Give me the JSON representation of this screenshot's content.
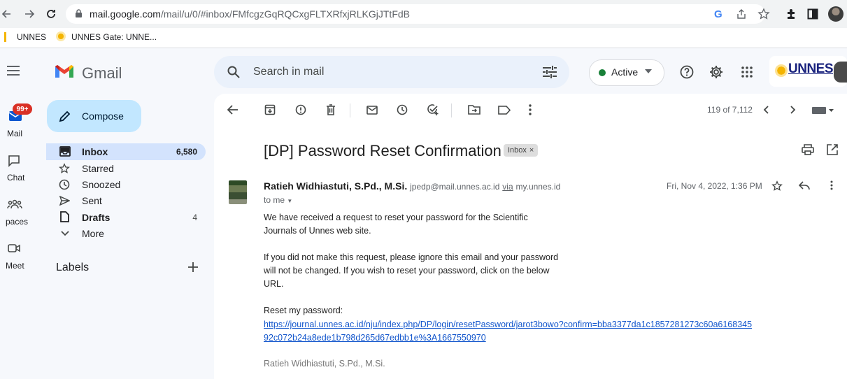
{
  "browser": {
    "url_host": "mail.google.com",
    "url_path": "/mail/u/0/#inbox/FMfcgzGqRQCxgFLTXRfxjRLKGjJTtFdB",
    "bookmarks": [
      "UNNES",
      "UNNES Gate: UNNE..."
    ]
  },
  "header": {
    "app_name": "Gmail",
    "search_placeholder": "Search in mail",
    "status_label": "Active",
    "brand_text": "UNNES"
  },
  "rail": {
    "mail_badge": "99+",
    "items": [
      "Mail",
      "Chat",
      "Spaces",
      "Meet"
    ],
    "items_visible": [
      "Mail",
      "Chat",
      "paces",
      "Meet"
    ]
  },
  "compose_label": "Compose",
  "nav": [
    {
      "label": "Inbox",
      "count": "6,580",
      "active": true,
      "bold": true
    },
    {
      "label": "Starred",
      "count": ""
    },
    {
      "label": "Snoozed",
      "count": ""
    },
    {
      "label": "Sent",
      "count": ""
    },
    {
      "label": "Drafts",
      "count": "4",
      "bold": true
    },
    {
      "label": "More",
      "count": ""
    }
  ],
  "labels_title": "Labels",
  "toolbar": {
    "pager": "119 of 7,112"
  },
  "email": {
    "subject": "[DP] Password Reset Confirmation",
    "chip": "Inbox",
    "sender_name": "Ratieh Widhiastuti, S.Pd., M.Si.",
    "sender_email": "jpedp@mail.unnes.ac.id",
    "via_label": "via",
    "via_domain": "my.unnes.id",
    "to": "to me",
    "date": "Fri, Nov 4, 2022, 1:36 PM",
    "paragraph1": "We have received a request to reset your password for the Scientific Journals of Unnes web site.",
    "paragraph2": "If you did not make this request, please ignore this email and your password will not be changed. If you wish to reset your password, click on the below URL.",
    "reset_label": "Reset my password:",
    "reset_link": "https://journal.unnes.ac.id/nju/index.php/DP/login/resetPassword/jarot3bowo?confirm=bba3377da1c1857281273c60a616834592c072b24a8ede1b798d265d67edbb1e%3A1667550970",
    "signature": "Ratieh Widhiastuti, S.Pd., M.Si."
  }
}
